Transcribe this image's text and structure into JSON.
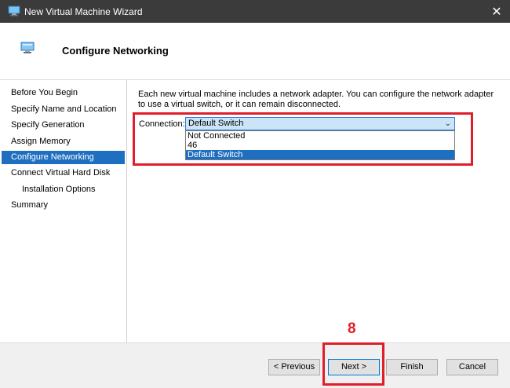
{
  "window": {
    "title": "New Virtual Machine Wizard",
    "close_glyph": "✕"
  },
  "header": {
    "title": "Configure Networking"
  },
  "nav": {
    "items": [
      {
        "label": "Before You Begin"
      },
      {
        "label": "Specify Name and Location"
      },
      {
        "label": "Specify Generation"
      },
      {
        "label": "Assign Memory"
      },
      {
        "label": "Configure Networking",
        "active": true
      },
      {
        "label": "Connect Virtual Hard Disk"
      },
      {
        "label": "Installation Options"
      },
      {
        "label": "Summary"
      }
    ]
  },
  "main": {
    "description": "Each new virtual machine includes a network adapter. You can configure the network adapter to use a virtual switch, or it can remain disconnected.",
    "connection_label": "Connection:",
    "connection_value": "Default Switch",
    "options": [
      "Not Connected",
      "46",
      "Default Switch"
    ]
  },
  "annotation": {
    "step_number": "8"
  },
  "footer": {
    "previous": "< Previous",
    "next": "Next >",
    "finish": "Finish",
    "cancel": "Cancel"
  },
  "colors": {
    "accent": "#1f6fc1",
    "highlight": "#e11d2a"
  }
}
